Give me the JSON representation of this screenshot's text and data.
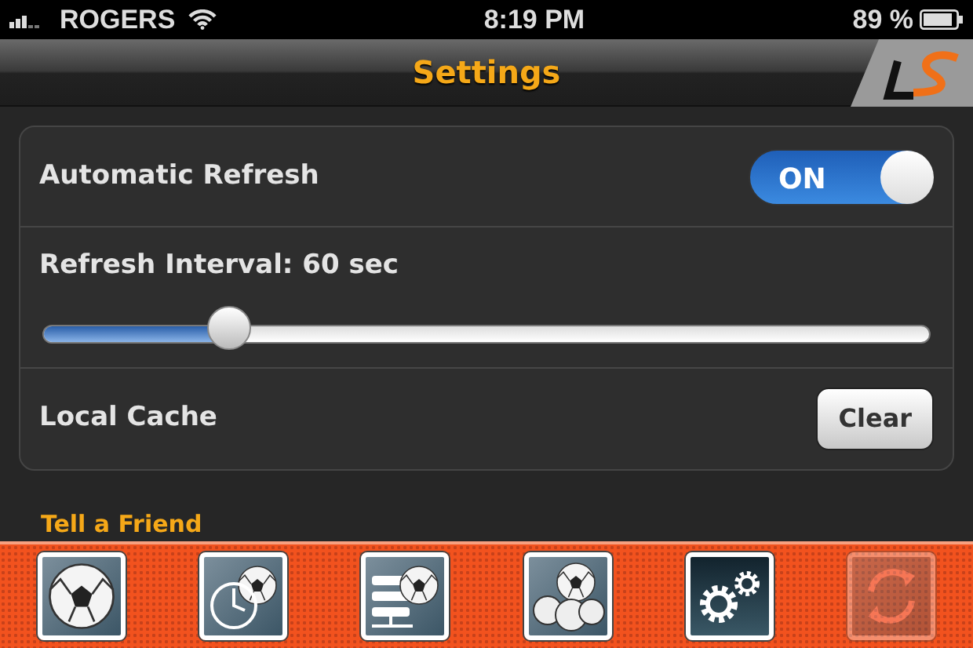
{
  "status_bar": {
    "carrier": "ROGERS",
    "time": "8:19 PM",
    "battery": "89 %"
  },
  "nav_bar": {
    "title": "Settings"
  },
  "settings": [
    {
      "kind": "switch",
      "label": "Automatic Refresh",
      "on": true,
      "switch_text": "ON"
    },
    {
      "kind": "slider",
      "label": "Refresh Interval: 60 sec",
      "level": 0.21
    },
    {
      "kind": "button",
      "label": "Local Cache",
      "button": "Clear"
    }
  ],
  "section_header": "Tell a Friend",
  "tabs": [
    {
      "kind": "ball",
      "selected": false,
      "disabled": false
    },
    {
      "kind": "clock",
      "selected": false,
      "disabled": false
    },
    {
      "kind": "list",
      "selected": false,
      "disabled": false
    },
    {
      "kind": "balls",
      "selected": false,
      "disabled": false
    },
    {
      "kind": "gears",
      "selected": true,
      "disabled": false
    },
    {
      "kind": "refresh",
      "selected": false,
      "disabled": true
    }
  ]
}
